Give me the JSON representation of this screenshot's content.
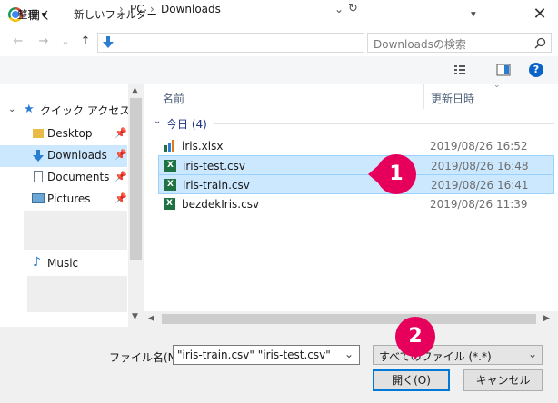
{
  "window": {
    "title": "開く",
    "close_symbol": "✕"
  },
  "nav": {
    "back": "←",
    "forward": "→",
    "history": "⌄",
    "up": "↑",
    "breadcrumb": [
      "PC",
      "Downloads"
    ],
    "dropdown": "⌄",
    "refresh": "↻",
    "search_placeholder": "Downloadsの検索"
  },
  "toolbar": {
    "organize": "整理 ▾",
    "new_folder": "新しいフォルダー",
    "view_menu": "▾",
    "help": "?"
  },
  "sidebar": {
    "quick_access": "クイック アクセス",
    "items": [
      {
        "label": "Desktop",
        "icon": "folder-icon"
      },
      {
        "label": "Downloads",
        "icon": "download-arrow-icon",
        "selected": true
      },
      {
        "label": "Documents",
        "icon": "document-icon"
      },
      {
        "label": "Pictures",
        "icon": "pictures-icon"
      },
      {
        "label": "Music",
        "icon": "music-note-icon"
      }
    ]
  },
  "file_list": {
    "columns": {
      "name": "名前",
      "modified": "更新日時"
    },
    "group": "今日 (4)",
    "files": [
      {
        "name": "iris.xlsx",
        "date": "2019/08/26 16:52",
        "icon": "xlsx-icon",
        "selected": false
      },
      {
        "name": "iris-test.csv",
        "date": "2019/08/26 16:48",
        "icon": "csv-excel-icon",
        "selected": true
      },
      {
        "name": "iris-train.csv",
        "date": "2019/08/26 16:41",
        "icon": "csv-excel-icon",
        "selected": true
      },
      {
        "name": "bezdekIris.csv",
        "date": "2019/08/26 11:39",
        "icon": "csv-excel-icon",
        "selected": false
      }
    ]
  },
  "bottom": {
    "filename_label": "ファイル名(N):",
    "filename_value": "\"iris-train.csv\" \"iris-test.csv\"",
    "filter_value": "すべてのファイル (*.*)",
    "open_button": "開く(O)",
    "cancel_button": "キャンセル"
  },
  "annotations": {
    "badge1": "1",
    "badge2": "2"
  },
  "colors": {
    "badge": "#e6005c",
    "selection": "#cce8ff",
    "accent": "#0078d7"
  }
}
